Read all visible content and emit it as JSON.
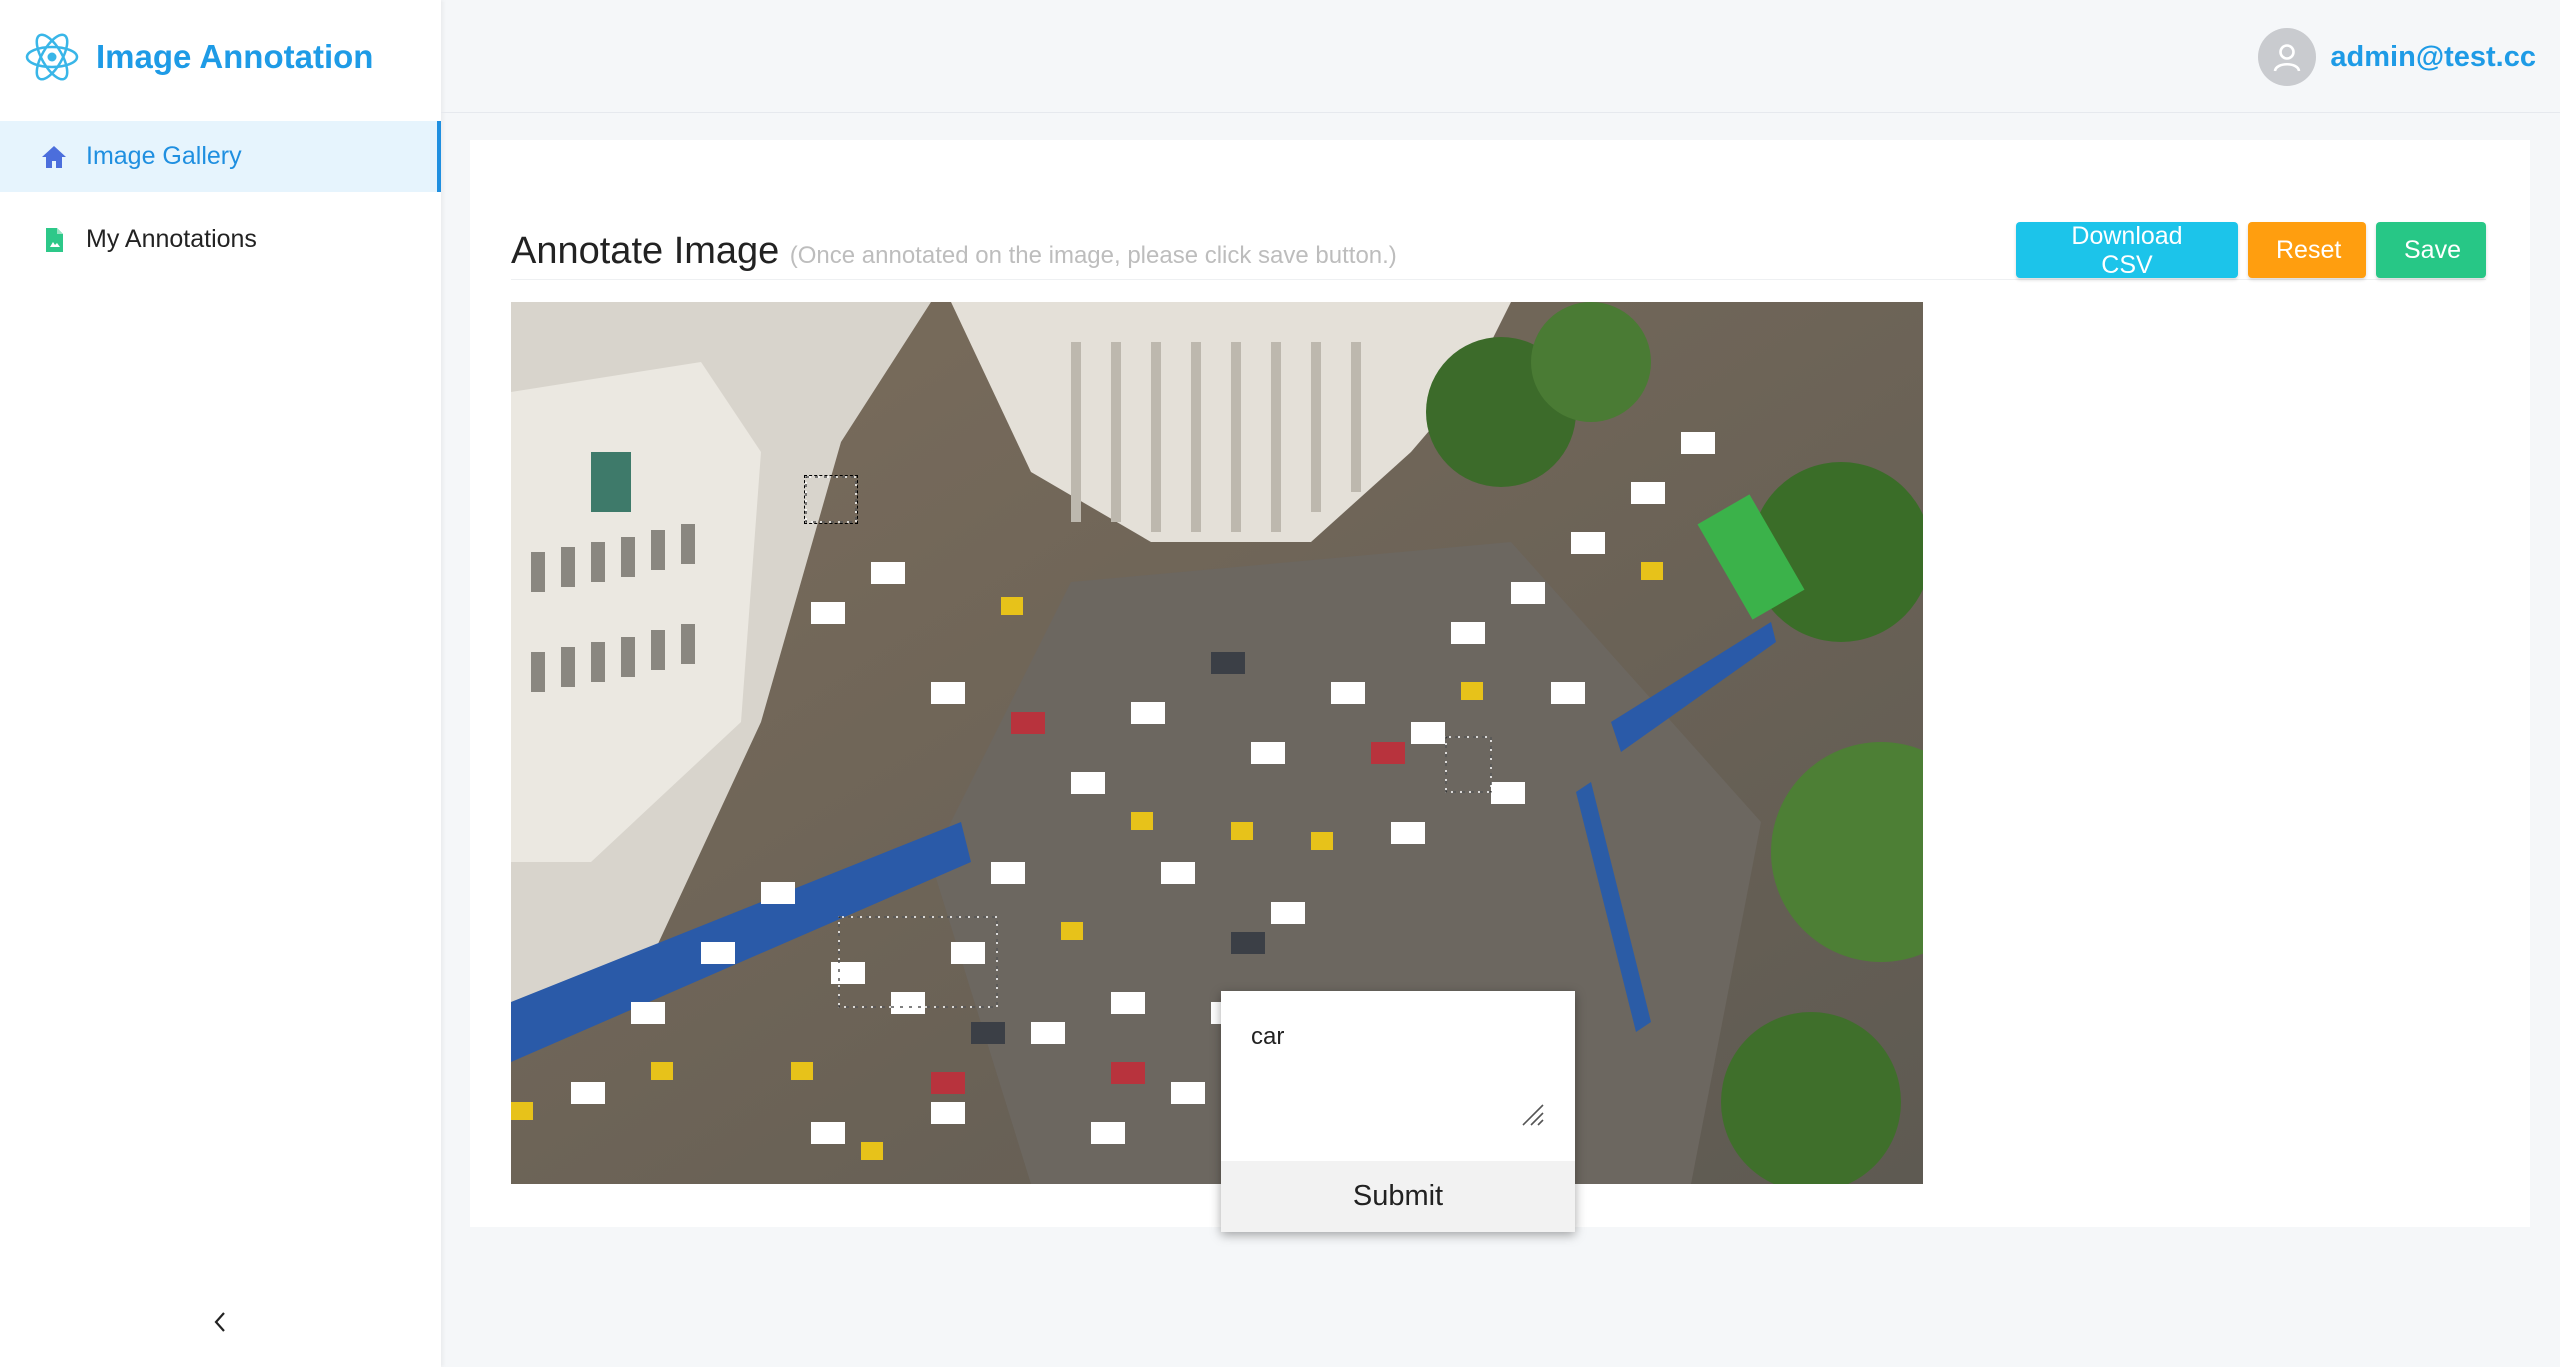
{
  "app": {
    "title": "Image Annotation"
  },
  "sidebar": {
    "items": [
      {
        "label": "Image Gallery",
        "icon": "home-icon",
        "active": true
      },
      {
        "label": "My Annotations",
        "icon": "document-icon",
        "active": false
      }
    ],
    "collapse_icon": "chevron-left-icon"
  },
  "header": {
    "user_email": "admin@test.cc",
    "avatar_icon": "user-icon"
  },
  "page": {
    "title": "Annotate Image",
    "subtitle": "(Once annotated on the image, please click save button.)"
  },
  "toolbar": {
    "download_label": "Download CSV",
    "reset_label": "Reset",
    "save_label": "Save"
  },
  "annotation_popup": {
    "value": "car",
    "submit_label": "Submit"
  },
  "colors": {
    "brand": "#1e9be6",
    "download": "#1cc4ea",
    "reset": "#ff9e0f",
    "save": "#27c786"
  }
}
